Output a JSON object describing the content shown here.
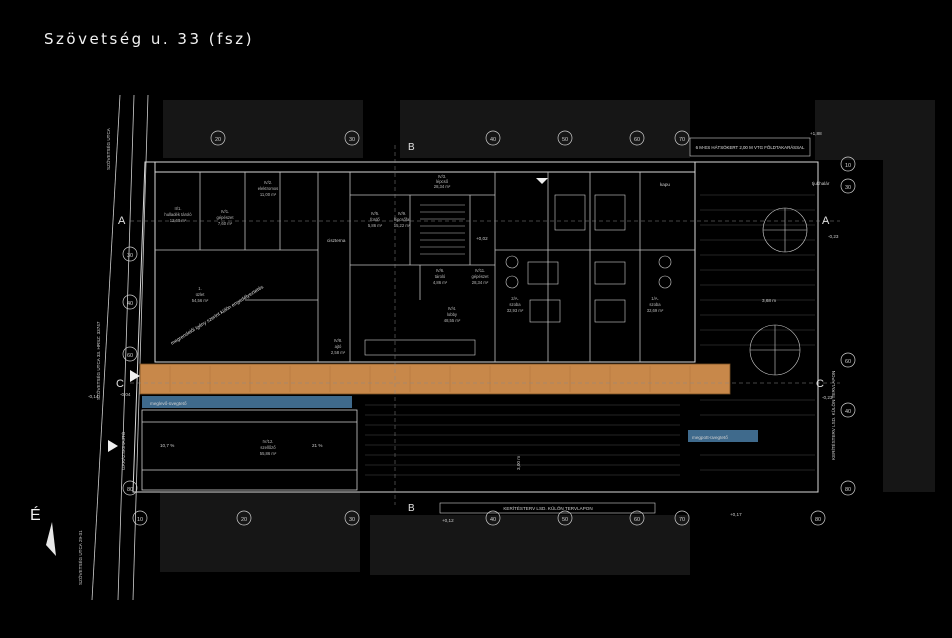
{
  "title": "Szövetség u. 33 (fsz)",
  "colors": {
    "background": "#000000",
    "line": "#cfcfcf",
    "corridor": "#c8884a",
    "glass": "#3f6a8c",
    "neighbor": "#161616"
  },
  "north_label": "É",
  "streets": {
    "left_main": "SZÖVETSÉG UTCA",
    "left_lower": "SZÖVETSÉG UTCA 33. HRSZ: 33747",
    "garage_exit": "GARÁZSKIHAJTÓ",
    "left_bottom": "SZÖVETSÉG UTCA 29-31"
  },
  "axes": {
    "letters_side": [
      "A",
      "B",
      "C"
    ],
    "top_numbers": [
      "10",
      "20",
      "30",
      "40",
      "50",
      "60",
      "70",
      "80"
    ],
    "side_codes": [
      {
        "letter": "B",
        "num": "10"
      },
      {
        "letter": "A",
        "num": "30"
      },
      {
        "letter": "B",
        "num": "40"
      },
      {
        "letter": "C",
        "num": "60"
      },
      {
        "letter": "B",
        "num": "80"
      }
    ]
  },
  "annotations": {
    "backyard": "6 M-ES HÁTSÓKERT 2,00 M VTG FÖLDTAKARÁSSAL",
    "elev_top": "+1,88",
    "elev_a": "-0,23",
    "elev_c": "-0,23",
    "elev_left": "-0,14",
    "elev_left2": "-0,04",
    "elev_bottom1": "+0,12",
    "elev_bottom2": "+0,17",
    "elev_center": "+0,02",
    "fence_right": "KERÍTÉSTERV LSD. KÜLÖN TERVLAPON",
    "fence_bottom": "KERÍTÉSTERV LSD. KÜLÖN TERVLAPON",
    "tyuk": "tjukhalár",
    "separate_permit": "megrendelői igény szerint külön engedélyeztetés",
    "skylight_1": "meglevő-üvegtető",
    "skylight_2": "megpott-üvegtető",
    "ramp_pct_1": "10,7 %",
    "ramp_pct_2": "21 %",
    "height_300": "3,00 m",
    "height_368": "3,68 m",
    "cistern": "ciszterna",
    "gate": "kapu"
  },
  "rooms": [
    {
      "code": "II/1.",
      "name": "hulladék tároló",
      "area": "12,60 m²"
    },
    {
      "code": "IV/1.",
      "name": "gépészet",
      "area": "7,60 m²"
    },
    {
      "code": "IV/2.",
      "name": "elektromos",
      "area": "11,00 m²"
    },
    {
      "code": "IV/3.",
      "name": "lépcső",
      "area": "28,34 m²"
    },
    {
      "code": "IV/4.",
      "name": "lobby",
      "area": "48,55 m²"
    },
    {
      "code": "2/A.",
      "name": "szoba",
      "area": "32,93 m²"
    },
    {
      "code": "1/A.",
      "name": "szoba",
      "area": "32,69 m²"
    },
    {
      "code": "1.",
      "name": "üzlet",
      "area": "54,56 m²"
    },
    {
      "code": "IV/5.",
      "name": "fürdő",
      "area": "5,86 m²"
    },
    {
      "code": "IV/6.",
      "name": "tároló",
      "area": "4,86 m²"
    },
    {
      "code": "IV/8.",
      "name": "ajtó",
      "area": "2,58 m²"
    },
    {
      "code": "IV/9.",
      "name": "lépcsőfal",
      "area": "15,22 m²"
    },
    {
      "code": "IV/11.",
      "name": "gépészet",
      "area": "28,34 m²"
    },
    {
      "code": "IV/12.",
      "name": "szellőző",
      "area": "55,86 m²"
    }
  ]
}
